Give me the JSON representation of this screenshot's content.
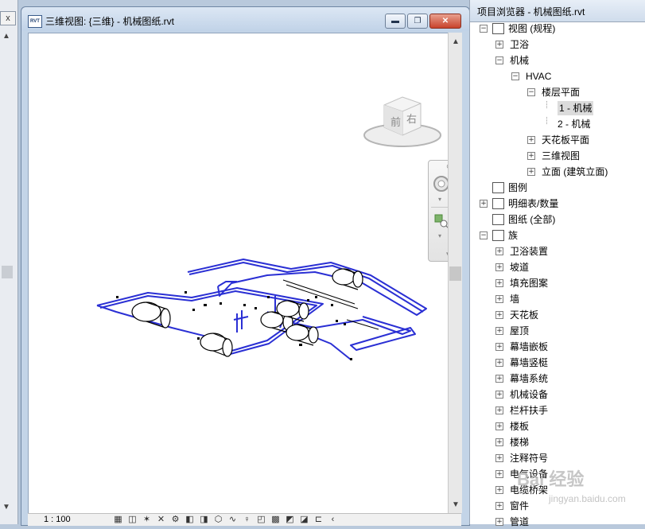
{
  "left_panel": {
    "close_glyph": "x",
    "scroll_up": "▲",
    "scroll_down": "▼"
  },
  "view_window": {
    "title": "三维视图: {三维} - 机械图纸.rvt",
    "icon_text": "RVT",
    "min_glyph": "▬",
    "max_glyph": "❐",
    "close_glyph": "✕",
    "scroll_up": "▲",
    "scroll_down": "▼",
    "view_cube": {
      "front_label": "前",
      "right_label": "右"
    },
    "statusbar": {
      "scale": "1 : 100",
      "icons": [
        "detail-level-icon",
        "visual-style-icon",
        "sun-path-icon",
        "shadows-icon",
        "render-icon",
        "crop-icon",
        "show-crop-icon",
        "unlock-3d-icon",
        "temp-hide-icon",
        "reveal-hidden-icon",
        "analysis-icon",
        "highlight-icon",
        "worksets-icon",
        "design-options-icon",
        "crop-region-icon",
        "more-icon"
      ],
      "icon_glyphs": [
        "▦",
        "◫",
        "✶",
        "✕",
        "⚙",
        "◧",
        "◨",
        "⬡",
        "∿",
        "♀",
        "◰",
        "▩",
        "◩",
        "◪",
        "⊏",
        "‹"
      ]
    },
    "colors": {
      "pipe": "#2a2fd4",
      "equipment": "#000000"
    }
  },
  "browser": {
    "title": "项目浏览器 - 机械图纸.rvt",
    "tree": [
      {
        "label": "视图 (规程)",
        "level": 0,
        "expander": "−",
        "icon": "views-icon"
      },
      {
        "label": "卫浴",
        "level": 1,
        "expander": "+"
      },
      {
        "label": "机械",
        "level": 1,
        "expander": "−"
      },
      {
        "label": "HVAC",
        "level": 2,
        "expander": "−"
      },
      {
        "label": "楼层平面",
        "level": 3,
        "expander": "−"
      },
      {
        "label": "1 - 机械",
        "level": 4,
        "expander": "",
        "selected": true
      },
      {
        "label": "2 - 机械",
        "level": 4,
        "expander": ""
      },
      {
        "label": "天花板平面",
        "level": 3,
        "expander": "+"
      },
      {
        "label": "三维视图",
        "level": 3,
        "expander": "+"
      },
      {
        "label": "立面 (建筑立面)",
        "level": 3,
        "expander": "+"
      },
      {
        "label": "图例",
        "level": 0,
        "expander": "",
        "icon": "legend-icon"
      },
      {
        "label": "明细表/数量",
        "level": 0,
        "expander": "+",
        "icon": "schedule-icon"
      },
      {
        "label": "图纸 (全部)",
        "level": 0,
        "expander": "",
        "icon": "sheet-icon"
      },
      {
        "label": "族",
        "level": 0,
        "expander": "−",
        "icon": "family-icon"
      },
      {
        "label": "卫浴装置",
        "level": 1,
        "expander": "+"
      },
      {
        "label": "坡道",
        "level": 1,
        "expander": "+"
      },
      {
        "label": "填充图案",
        "level": 1,
        "expander": "+"
      },
      {
        "label": "墙",
        "level": 1,
        "expander": "+"
      },
      {
        "label": "天花板",
        "level": 1,
        "expander": "+"
      },
      {
        "label": "屋顶",
        "level": 1,
        "expander": "+"
      },
      {
        "label": "幕墙嵌板",
        "level": 1,
        "expander": "+"
      },
      {
        "label": "幕墙竖梃",
        "level": 1,
        "expander": "+"
      },
      {
        "label": "幕墙系统",
        "level": 1,
        "expander": "+"
      },
      {
        "label": "机械设备",
        "level": 1,
        "expander": "+"
      },
      {
        "label": "栏杆扶手",
        "level": 1,
        "expander": "+"
      },
      {
        "label": "楼板",
        "level": 1,
        "expander": "+"
      },
      {
        "label": "楼梯",
        "level": 1,
        "expander": "+"
      },
      {
        "label": "注释符号",
        "level": 1,
        "expander": "+"
      },
      {
        "label": "电气设备",
        "level": 1,
        "expander": "+"
      },
      {
        "label": "电缆桥架",
        "level": 1,
        "expander": "+"
      },
      {
        "label": "窗件",
        "level": 1,
        "expander": "+"
      },
      {
        "label": "管道",
        "level": 1,
        "expander": "+"
      }
    ]
  },
  "watermark": {
    "brand": "Bai 经验",
    "url": "jingyan.baidu.com"
  }
}
